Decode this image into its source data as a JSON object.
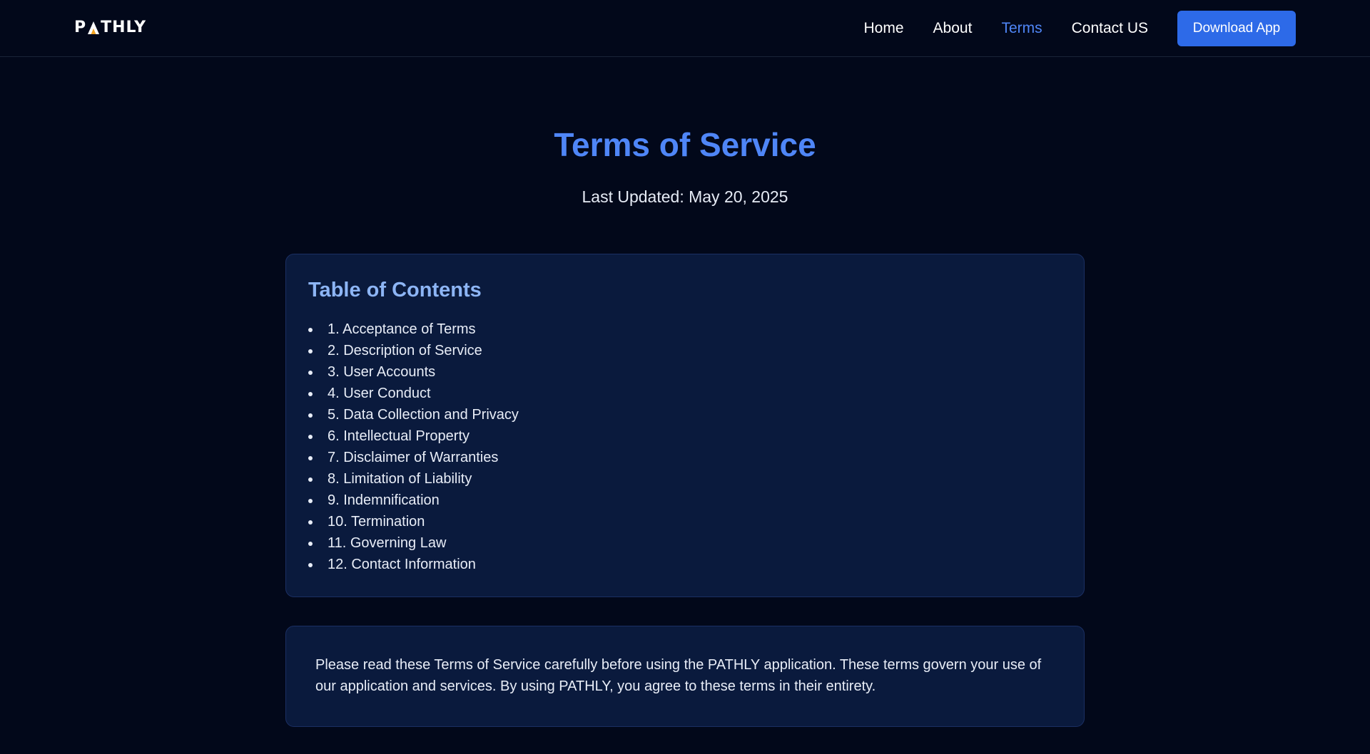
{
  "brand": {
    "logo_left": "P",
    "logo_right": "THLY",
    "logo_full": "PATHLY",
    "accent_color": "#4f86f7",
    "button_color": "#2d6ae8",
    "background_color": "#02081a",
    "card_color": "#0a1a3d",
    "logo_accent_color": "#f5a524"
  },
  "nav": {
    "links": [
      {
        "label": "Home"
      },
      {
        "label": "About"
      },
      {
        "label": "Terms",
        "active": true
      },
      {
        "label": "Contact US"
      }
    ],
    "download_label": "Download App"
  },
  "header": {
    "title": "Terms of Service",
    "last_updated": "Last Updated: May 20, 2025"
  },
  "toc": {
    "title": "Table of Contents",
    "items": [
      "1. Acceptance of Terms",
      "2. Description of Service",
      "3. User Accounts",
      "4. User Conduct",
      "5. Data Collection and Privacy",
      "6. Intellectual Property",
      "7. Disclaimer of Warranties",
      "8. Limitation of Liability",
      "9. Indemnification",
      "10. Termination",
      "11. Governing Law",
      "12. Contact Information"
    ]
  },
  "intro": {
    "text": "Please read these Terms of Service carefully before using the PATHLY application. These terms govern your use of our application and services. By using PATHLY, you agree to these terms in their entirety."
  }
}
